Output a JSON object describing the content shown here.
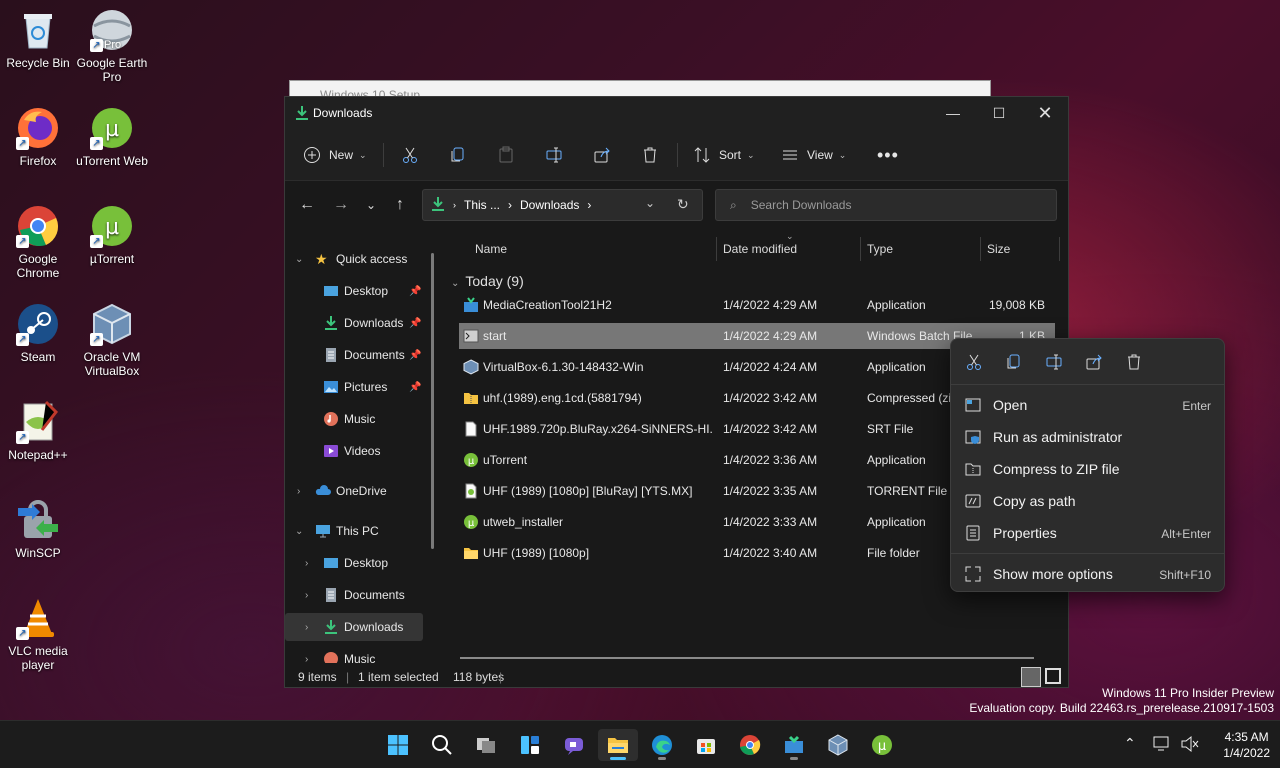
{
  "desktop": {
    "icons": [
      {
        "label": "Recycle Bin",
        "icon": "recycle-bin-icon"
      },
      {
        "label": "Google Earth Pro",
        "icon": "google-earth-icon",
        "badge": "Pro"
      },
      {
        "label": "Firefox",
        "icon": "firefox-icon"
      },
      {
        "label": "uTorrent Web",
        "icon": "utorrent-web-icon"
      },
      {
        "label": "Google Chrome",
        "icon": "chrome-icon"
      },
      {
        "label": "µTorrent",
        "icon": "utorrent-icon"
      },
      {
        "label": "Steam",
        "icon": "steam-icon"
      },
      {
        "label": "Oracle VM VirtualBox",
        "icon": "virtualbox-icon"
      },
      {
        "label": "Notepad++",
        "icon": "notepadpp-icon"
      },
      {
        "label": "WinSCP",
        "icon": "winscp-icon"
      },
      {
        "label": "VLC media player",
        "icon": "vlc-icon"
      }
    ]
  },
  "background_window": {
    "title": "Windows 10 Setup"
  },
  "explorer": {
    "title": "Downloads",
    "toolbar": {
      "new_label": "New",
      "sort_label": "Sort",
      "view_label": "View"
    },
    "breadcrumb": {
      "part1": "This ...",
      "part2": "Downloads"
    },
    "search_placeholder": "Search Downloads",
    "nav": {
      "quick_access": "Quick access",
      "desktop": "Desktop",
      "downloads": "Downloads",
      "documents": "Documents",
      "pictures": "Pictures",
      "music": "Music",
      "videos": "Videos",
      "onedrive": "OneDrive",
      "this_pc": "This PC",
      "pc_desktop": "Desktop",
      "pc_documents": "Documents",
      "pc_downloads": "Downloads",
      "pc_music": "Music"
    },
    "columns": {
      "name": "Name",
      "date": "Date modified",
      "type": "Type",
      "size": "Size"
    },
    "group": "Today (9)",
    "files": [
      {
        "name": "MediaCreationTool21H2",
        "date": "1/4/2022 4:29 AM",
        "type": "Application",
        "size": "19,008 KB"
      },
      {
        "name": "start",
        "date": "1/4/2022 4:29 AM",
        "type": "Windows Batch File",
        "size": "1 KB"
      },
      {
        "name": "VirtualBox-6.1.30-148432-Win",
        "date": "1/4/2022 4:24 AM",
        "type": "Application",
        "size": ""
      },
      {
        "name": "uhf.(1989).eng.1cd.(5881794)",
        "date": "1/4/2022 3:42 AM",
        "type": "Compressed (zip",
        "size": ""
      },
      {
        "name": "UHF.1989.720p.BluRay.x264-SiNNERS-HI....",
        "date": "1/4/2022 3:42 AM",
        "type": "SRT File",
        "size": ""
      },
      {
        "name": "uTorrent",
        "date": "1/4/2022 3:36 AM",
        "type": "Application",
        "size": ""
      },
      {
        "name": "UHF (1989) [1080p] [BluRay] [YTS.MX]",
        "date": "1/4/2022 3:35 AM",
        "type": "TORRENT File",
        "size": ""
      },
      {
        "name": "utweb_installer",
        "date": "1/4/2022 3:33 AM",
        "type": "Application",
        "size": ""
      },
      {
        "name": "UHF (1989) [1080p]",
        "date": "1/4/2022 3:40 AM",
        "type": "File folder",
        "size": ""
      }
    ],
    "status": {
      "count": "9 items",
      "selected": "1 item selected",
      "size": "118 bytes"
    }
  },
  "context_menu": {
    "items": [
      {
        "label": "Open",
        "shortcut": "Enter"
      },
      {
        "label": "Run as administrator",
        "shortcut": ""
      },
      {
        "label": "Compress to ZIP file",
        "shortcut": ""
      },
      {
        "label": "Copy as path",
        "shortcut": ""
      },
      {
        "label": "Properties",
        "shortcut": "Alt+Enter"
      },
      {
        "label": "Show more options",
        "shortcut": "Shift+F10"
      }
    ]
  },
  "watermark": {
    "line1": "Windows 11 Pro Insider Preview",
    "line2": "Evaluation copy. Build 22463.rs_prerelease.210917-1503"
  },
  "taskbar": {
    "time": "4:35 AM",
    "date": "1/4/2022"
  },
  "colors": {
    "accent": "#4cc2ff",
    "selection": "#777777",
    "folder": "#f5c342",
    "downloads_green": "#3cc47c"
  }
}
